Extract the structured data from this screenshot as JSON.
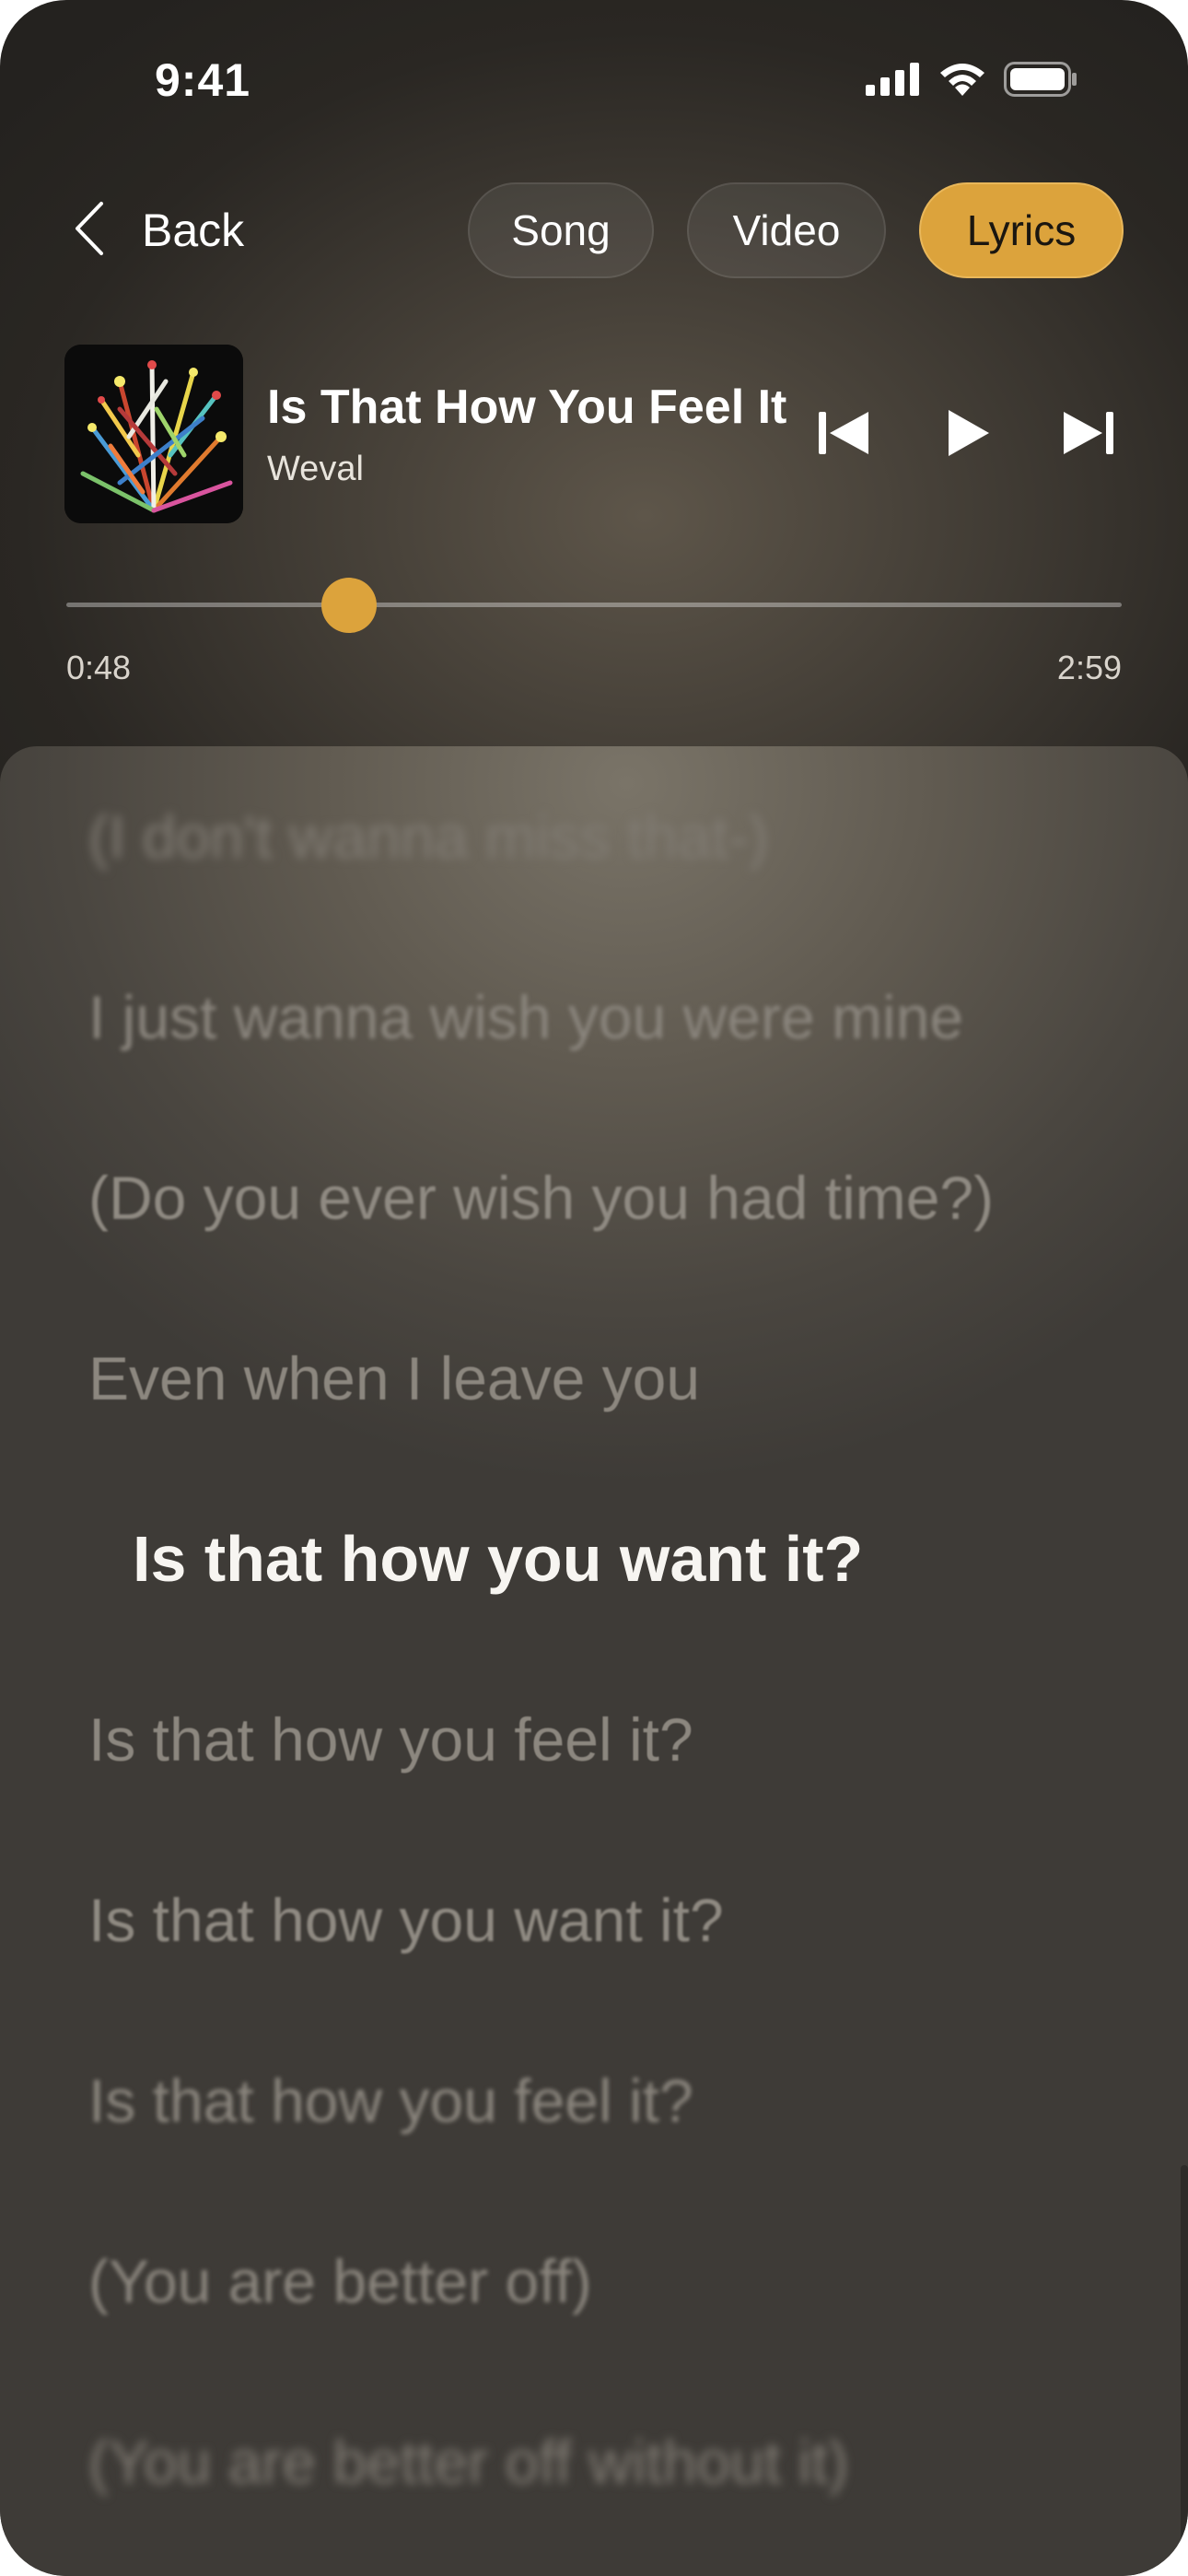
{
  "status_bar": {
    "time": "9:41"
  },
  "header": {
    "back_label": "Back",
    "tabs": [
      {
        "label": "Song",
        "active": false
      },
      {
        "label": "Video",
        "active": false
      },
      {
        "label": "Lyrics",
        "active": true
      }
    ]
  },
  "now_playing": {
    "title": "Is That How You Feel It",
    "artist": "Weval",
    "elapsed": "0:48",
    "total": "2:59",
    "progress_fraction": 0.268
  },
  "lyrics": {
    "current_index": 4,
    "lines": [
      "(I don't wanna miss that-)",
      "I just wanna wish you were mine",
      "(Do you ever wish you had time?)",
      "Even when I leave you",
      "Is that how you want it?",
      "Is that how you feel it?",
      "Is that how you want it?",
      "Is that how you feel it?",
      "(You are better off)",
      "(You are better off without it)"
    ]
  },
  "colors": {
    "accent": "#dca33c",
    "text_primary": "#ffffff",
    "lyric_dim": "#8c877f"
  },
  "icons": {
    "back": "chevron-left-icon",
    "prev": "skip-previous-icon",
    "play": "play-icon",
    "next": "skip-next-icon",
    "signal": "cellular-signal-icon",
    "wifi": "wifi-icon",
    "battery": "battery-icon"
  }
}
